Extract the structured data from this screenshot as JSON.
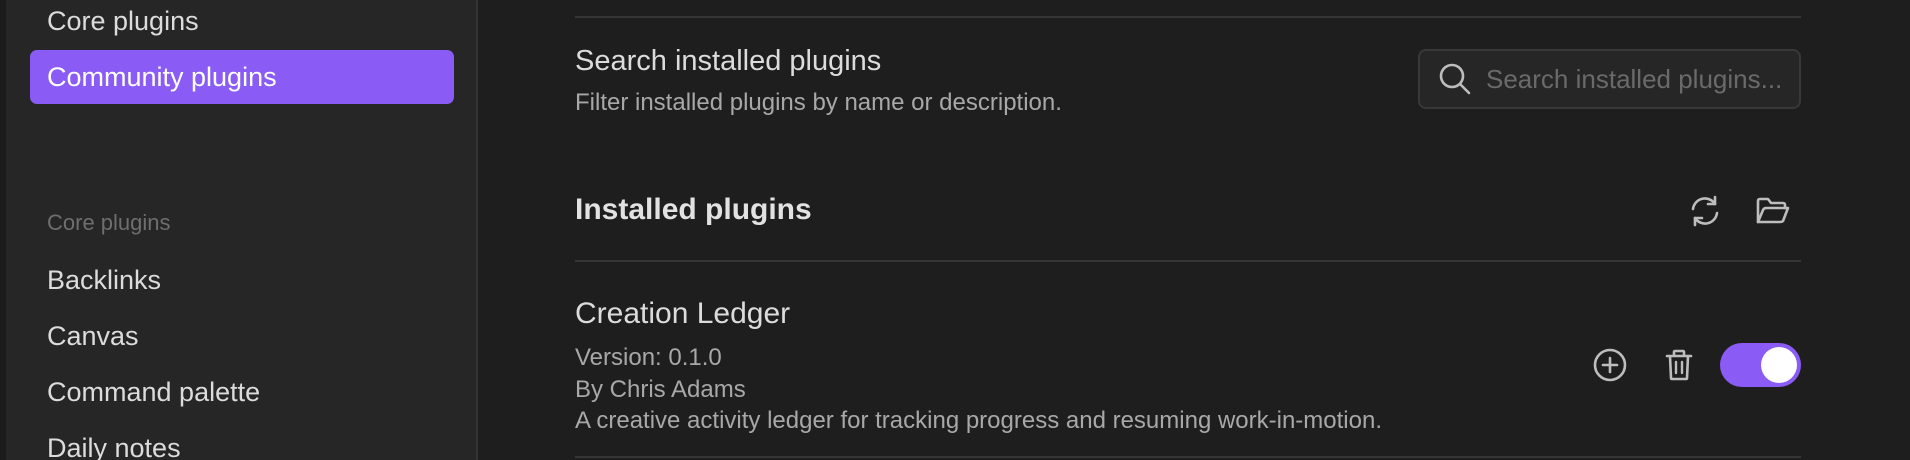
{
  "sidebar": {
    "options_items": [
      {
        "label": "Core plugins"
      },
      {
        "label": "Community plugins",
        "active": true
      }
    ],
    "core_plugins_heading": "Core plugins",
    "core_plugins_items": [
      {
        "label": "Backlinks"
      },
      {
        "label": "Canvas"
      },
      {
        "label": "Command palette"
      },
      {
        "label": "Daily notes"
      }
    ]
  },
  "search_setting": {
    "name": "Search installed plugins",
    "description": "Filter installed plugins by name or description.",
    "placeholder": "Search installed plugins...",
    "icon": "search-icon"
  },
  "installed": {
    "heading": "Installed plugins",
    "reload_icon": "refresh-icon",
    "folder_icon": "folder-open-icon"
  },
  "plugins": [
    {
      "name": "Creation Ledger",
      "version": "Version: 0.1.0",
      "author": "By Chris Adams",
      "description": "A creative activity ledger for tracking progress and resuming work-in-motion.",
      "enabled": true,
      "options_icon": "plus-circle-icon",
      "uninstall_icon": "trash-icon"
    }
  ],
  "colors": {
    "accent": "#8a5cf5",
    "background": "#1e1e1e",
    "sidebar": "#262626"
  }
}
